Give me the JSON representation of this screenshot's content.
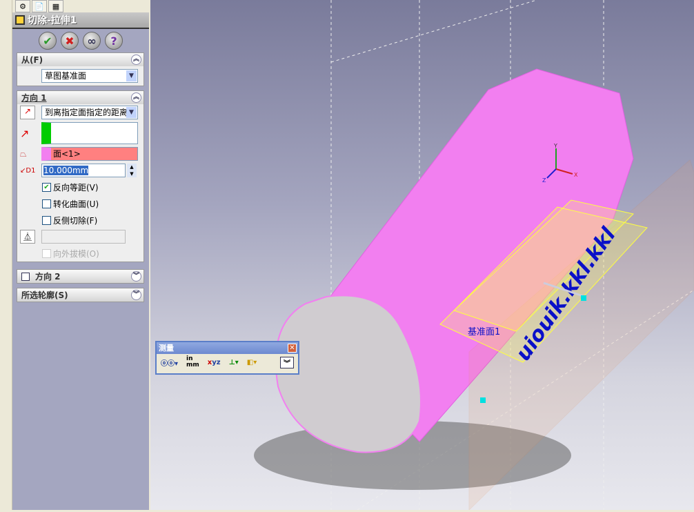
{
  "panel": {
    "title": "切除-拉伸1",
    "actions": [
      {
        "name": "ok",
        "glyph": "✔",
        "color": "#2a9a2a"
      },
      {
        "name": "cancel",
        "glyph": "✖",
        "color": "#d02020"
      },
      {
        "name": "preview",
        "glyph": "◎",
        "color": "#335"
      },
      {
        "name": "help",
        "glyph": "?",
        "color": "#7030a0"
      }
    ],
    "from": {
      "header": "从(F)",
      "value": "草图基准面"
    },
    "direction1": {
      "header": "方向 1",
      "end_condition": "到离指定面指定的距离",
      "face": "面<1>",
      "distance": "10.000mm",
      "options": [
        {
          "label": "反向等距(V)",
          "checked": true
        },
        {
          "label": "转化曲面(U)",
          "checked": false
        },
        {
          "label": "反侧切除(F)",
          "checked": false
        }
      ],
      "draft_outward": "向外拔模(O)"
    },
    "direction2": {
      "header": "方向 2",
      "checked": false
    },
    "contours": {
      "header": "所选轮廓(S)"
    }
  },
  "measure": {
    "title": "测量",
    "units": "in\nmm"
  },
  "viewport": {
    "sketch_text": "uiouik.kkl.kkl",
    "plane_label": "基准面1",
    "triad": {
      "x": "X",
      "y": "Y",
      "z": "Z"
    },
    "colors": {
      "cylinder": "#f27ff0",
      "end_face": "#d0ccd0",
      "text": "#0a10c8",
      "preview": "#ffff40",
      "plane": "#e08040"
    }
  }
}
